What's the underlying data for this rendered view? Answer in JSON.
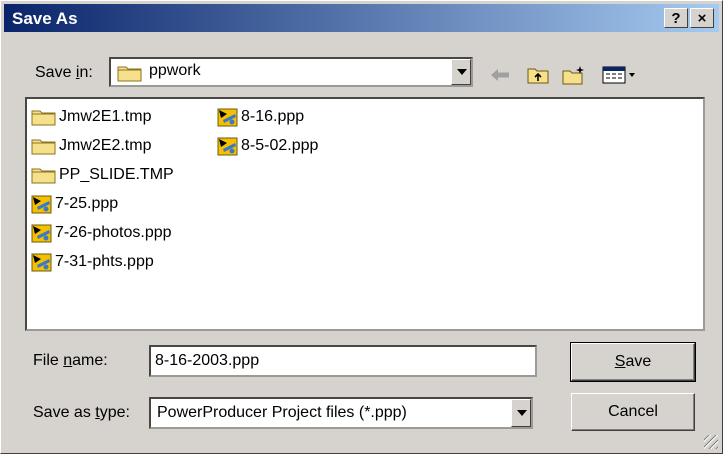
{
  "window": {
    "title": "Save As",
    "help_label": "?",
    "close_label": "×"
  },
  "toolbar": {
    "save_in_label_pre": "Save ",
    "save_in_label_key": "i",
    "save_in_label_post": "n:",
    "current_folder": "ppwork"
  },
  "files": [
    {
      "name": "Jmw2E1.tmp",
      "type": "folder"
    },
    {
      "name": "Jmw2E2.tmp",
      "type": "folder"
    },
    {
      "name": "PP_SLIDE.TMP",
      "type": "folder"
    },
    {
      "name": "7-25.ppp",
      "type": "project"
    },
    {
      "name": "7-26-photos.ppp",
      "type": "project"
    },
    {
      "name": "7-31-phts.ppp",
      "type": "project"
    },
    {
      "name": "8-16.ppp",
      "type": "project"
    },
    {
      "name": "8-5-02.ppp",
      "type": "project"
    }
  ],
  "filename": {
    "label_pre": "File ",
    "label_key": "n",
    "label_post": "ame:",
    "value": "8-16-2003.ppp"
  },
  "filetype": {
    "label_pre": "Save as ",
    "label_key": "t",
    "label_post": "ype:",
    "value": "PowerProducer Project files (*.ppp)"
  },
  "buttons": {
    "save_key": "S",
    "save_rest": "ave",
    "cancel": "Cancel"
  }
}
